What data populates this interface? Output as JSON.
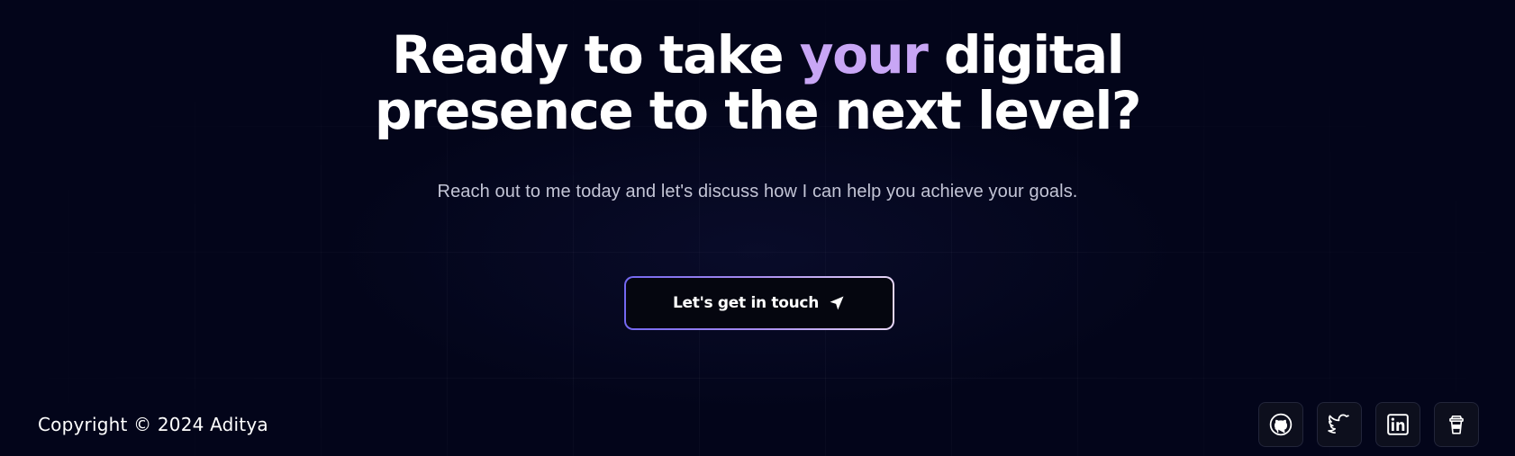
{
  "hero": {
    "headline_part1": "Ready to take ",
    "headline_accent": "your",
    "headline_part2": " digital presence to the next level?",
    "subtitle": "Reach out to me today and let's discuss how I can help you achieve your goals.",
    "cta_label": "Let's get in touch",
    "cta_icon": "send-icon"
  },
  "footer": {
    "copyright": "Copyright © 2024 Aditya",
    "socials": [
      {
        "icon": "github-icon"
      },
      {
        "icon": "twitter-icon"
      },
      {
        "icon": "linkedin-icon"
      },
      {
        "icon": "coffee-cup-icon"
      }
    ]
  },
  "colors": {
    "background": "#03051a",
    "accent": "#c8a6f5",
    "cta_border_start": "#7367f0",
    "cta_border_end": "#e7d6f6",
    "subtitle": "#c3c5d6"
  }
}
